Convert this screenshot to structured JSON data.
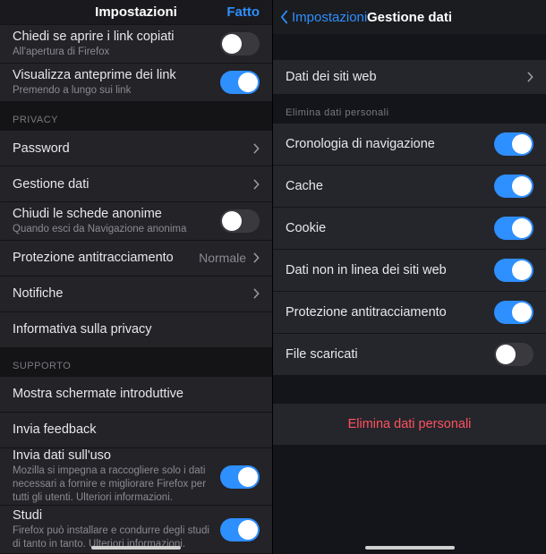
{
  "left": {
    "header": {
      "title": "Impostazioni",
      "done": "Fatto"
    },
    "rows": {
      "clipboard": {
        "label": "Chiedi se aprire i link copiati",
        "sublabel": "All'apertura di Firefox"
      },
      "preview": {
        "label": "Visualizza anteprime dei link",
        "sublabel": "Premendo a lungo sui link"
      }
    },
    "privacy": {
      "header": "PRIVACY",
      "password": "Password",
      "data_mgmt": "Gestione dati",
      "close_private": {
        "label": "Chiudi le schede anonime",
        "sublabel": "Quando esci da Navigazione anonima"
      },
      "tracking": {
        "label": "Protezione antitracciamento",
        "value": "Normale"
      },
      "notifications": "Notifiche",
      "privacy_info": "Informativa sulla privacy"
    },
    "support": {
      "header": "SUPPORTO",
      "intro": "Mostra schermate introduttive",
      "feedback": "Invia feedback",
      "usage": {
        "label": "Invia dati sull'uso",
        "sublabel": "Mozilla si impegna a raccogliere solo i dati necessari a fornire e migliorare Firefox per tutti gli utenti. Ulteriori informazioni."
      },
      "studies": {
        "label": "Studi",
        "sublabel": "Firefox può installare e condurre degli studi di tanto in tanto. Ulteriori informazioni."
      }
    }
  },
  "right": {
    "header": {
      "back": "Impostazioni",
      "title": "Gestione dati"
    },
    "sitedata": "Dati dei siti web",
    "clear_header": "Elimina dati personali",
    "items": {
      "history": "Cronologia di navigazione",
      "cache": "Cache",
      "cookie": "Cookie",
      "offline": "Dati non in linea dei siti web",
      "tracking": "Protezione antitracciamento",
      "downloads": "File scaricati"
    },
    "destructive": "Elimina dati personali"
  }
}
